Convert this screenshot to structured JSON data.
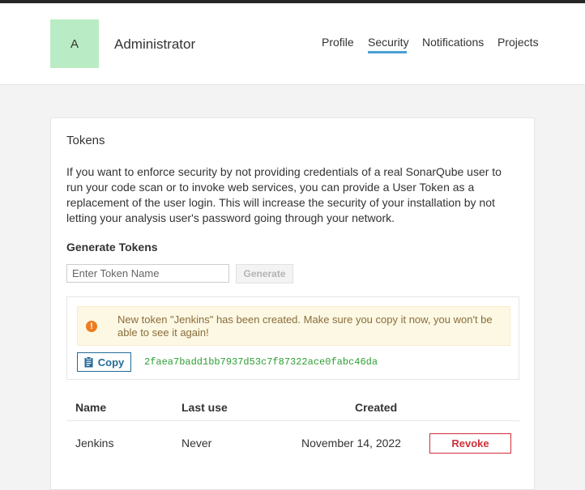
{
  "header": {
    "avatar_letter": "A",
    "username": "Administrator",
    "nav": [
      "Profile",
      "Security",
      "Notifications",
      "Projects"
    ],
    "active_tab": "Security"
  },
  "tokens": {
    "title": "Tokens",
    "description": "If you want to enforce security by not providing credentials of a real SonarQube user to run your code scan or to invoke web services, you can provide a User Token as a replacement of the user login. This will increase the security of your installation by not letting your analysis user's password going through your network.",
    "generate_title": "Generate Tokens",
    "input_placeholder": "Enter Token Name",
    "generate_label": "Generate",
    "alert_icon": "exclamation-icon",
    "alert_text": "New token \"Jenkins\" has been created. Make sure you copy it now, you won't be able to see it again!",
    "copy_label": "Copy",
    "token_value": "2faea7badd1bb7937d53c7f87322ace0fabc46da",
    "table": {
      "columns": [
        "Name",
        "Last use",
        "Created"
      ],
      "rows": [
        {
          "name": "Jenkins",
          "last_use": "Never",
          "created": "November 14, 2022",
          "action": "Revoke"
        }
      ]
    }
  },
  "colors": {
    "avatar_bg": "#b9ecc4",
    "nav_underline": "#4b9fd5",
    "alert_bg": "#fcf8e3",
    "alert_icon": "#ed7d20",
    "token_text": "#2d9e32",
    "copy_border": "#236a97",
    "revoke": "#d02f3a"
  }
}
